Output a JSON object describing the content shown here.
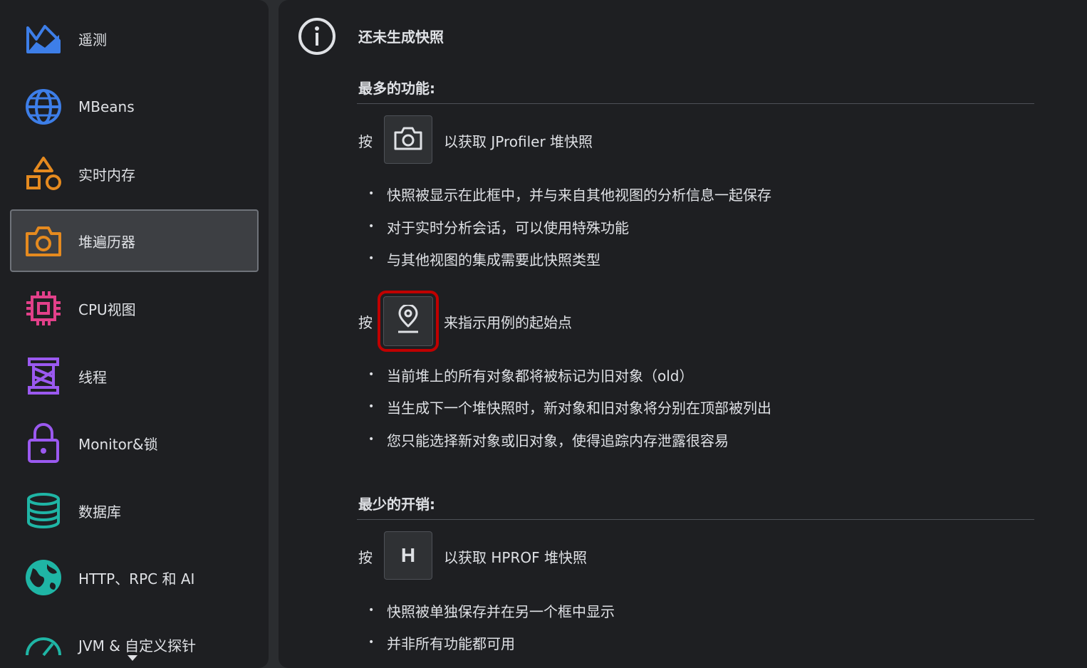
{
  "sidebar": {
    "items": [
      {
        "label": "遥测",
        "icon": "telemetry-icon",
        "color": "#3d7ee8"
      },
      {
        "label": "MBeans",
        "icon": "globe-icon",
        "color": "#3d7ee8"
      },
      {
        "label": "实时内存",
        "icon": "shapes-icon",
        "color": "#e58a1f"
      },
      {
        "label": "堆遍历器",
        "icon": "camera-icon",
        "color": "#e58a1f",
        "selected": true
      },
      {
        "label": "CPU视图",
        "icon": "cpu-chip-icon",
        "color": "#e2408a"
      },
      {
        "label": "线程",
        "icon": "spool-icon",
        "color": "#9b59f0"
      },
      {
        "label": "Monitor&锁",
        "icon": "lock-icon",
        "color": "#9b59f0"
      },
      {
        "label": "数据库",
        "icon": "database-icon",
        "color": "#1fb5a5"
      },
      {
        "label": "HTTP、RPC 和 AI",
        "icon": "network-globe-icon",
        "color": "#1fb5a5"
      },
      {
        "label": "JVM & 自定义探针",
        "icon": "gauge-icon",
        "color": "#1fb5a5"
      }
    ]
  },
  "main": {
    "title": "还未生成快照",
    "section1": {
      "heading": "最多的功能:",
      "press": "按",
      "action1": "以获取 JProfiler 堆快照",
      "bullets1": [
        "快照被显示在此框中，并与来自其他视图的分析信息一起保存",
        "对于实时分析会话，可以使用特殊功能",
        "与其他视图的集成需要此快照类型"
      ],
      "press2": "按",
      "action2": "来指示用例的起始点",
      "bullets2": [
        "当前堆上的所有对象都将被标记为旧对象（old）",
        "当生成下一个堆快照时，新对象和旧对象将分别在顶部被列出",
        "您只能选择新对象或旧对象，使得追踪内存泄露很容易"
      ]
    },
    "section2": {
      "heading": "最少的开销:",
      "press": "按",
      "key_label": "H",
      "action": "以获取 HPROF 堆快照",
      "bullets": [
        "快照被单独保存并在另一个框中显示",
        "并非所有功能都可用"
      ]
    }
  }
}
